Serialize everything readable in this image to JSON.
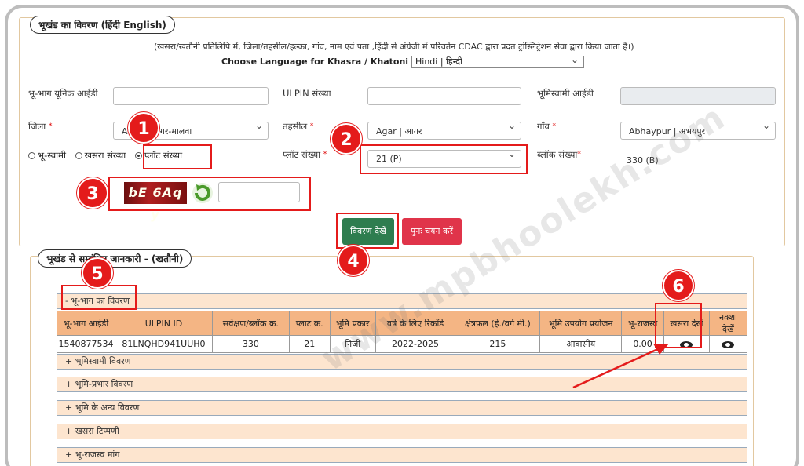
{
  "section1": {
    "legend": "भूखंड का विवरण  (हिंदी  English)",
    "note": "(खसरा/खतौनी प्रतिलिपि में, जिला/तहसील/हल्का, गांव, नाम एवं पता ,हिंदी से अंग्रेजी में परिवर्तन CDAC द्वारा प्रदत ट्रांस्लिट्रेशन सेवा द्वारा किया जाता है।)",
    "lang_label": "Choose Language for Khasra / Khatoni Copy:",
    "lang_value": "Hindi | हिन्दी"
  },
  "fields": {
    "unique_id_label": "भू-भाग यूनिक आईडी",
    "ulpin_label": "ULPIN संख्या",
    "owner_id_label": "भूमिस्वामी आईडी",
    "district_label": "जिला",
    "district_value": "Agar-Malwa | आगर-मालवा",
    "district_visible": "A        wa | आगर-मालवा",
    "tehsil_label": "तहसील",
    "tehsil_value": "Agar | आगर",
    "village_label": "गाँव",
    "village_value": "Abhaypur | अभयपुर",
    "plot_label": "प्लॉट संख्या",
    "plot_value": "21 (P)",
    "block_label": "ब्लॉक संख्या",
    "block_value": "330 (B)",
    "required_mark": "*"
  },
  "radios": {
    "opt1": "भू-स्वामी",
    "opt2": "खसरा संख्या",
    "opt3": "प्लॉट संख्या"
  },
  "captcha": {
    "text": "bE 6Aq y"
  },
  "buttons": {
    "view": "विवरण देखें",
    "reset": "पुनः चयन करें"
  },
  "section2": {
    "legend": "भूखंड से सम्बंधित जानकारी -   (खतौनी)",
    "plot_details": "- भू-भाग का विवरण",
    "headers": [
      "भू-भाग आईडी",
      "ULPIN ID",
      "सर्वेक्षण/ब्लॉक क्र.",
      "प्लाट क्र.",
      "भूमि प्रकार",
      "वर्ष के लिए रिकॉर्ड",
      "क्षेत्रफल (हे./वर्ग मी.)",
      "भूमि उपयोग प्रयोजन",
      "भू-राजस्व",
      "खसरा देखें",
      "नक्शा देखें"
    ],
    "row": [
      "1540877534",
      "81LNQHD941UUH0",
      "330",
      "21",
      "निजी",
      "2022-2025",
      "215",
      "आवासीय",
      "0.00"
    ],
    "sections": [
      "+ भूमिस्वामी विवरण",
      "+ भूमि-प्रभार विवरण",
      "+ भूमि के अन्य विवरण",
      "+ खसरा टिप्पणी",
      "+ भू-राजस्व मांग"
    ]
  },
  "badges": [
    "1",
    "2",
    "3",
    "4",
    "5",
    "6"
  ],
  "watermark": "www.mpbhoolekh.com",
  "colors": {
    "annotation_red": "#e41b1b",
    "table_header": "#f4b584",
    "view_button": "#2e7d4f",
    "reset_button": "#e0344a"
  }
}
